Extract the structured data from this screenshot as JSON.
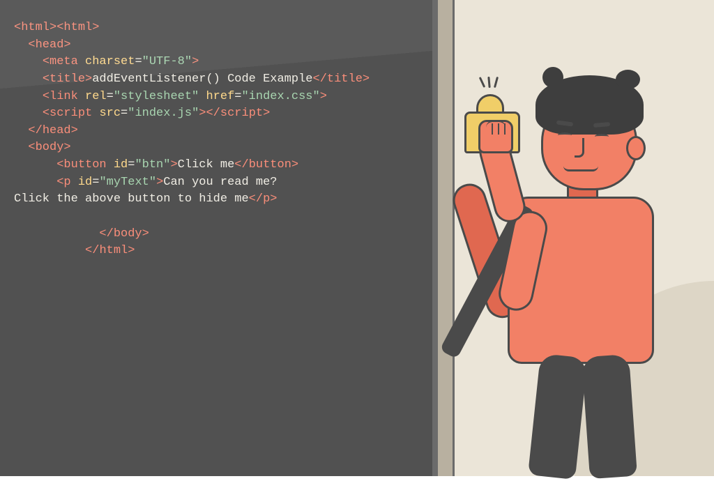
{
  "code": {
    "lines": [
      {
        "indent": 0,
        "segments": [
          {
            "t": "tag",
            "open": "<",
            "name": "html",
            "close": ">"
          },
          {
            "t": "tag",
            "open": "<",
            "name": "html",
            "close": ">"
          }
        ]
      },
      {
        "indent": 1,
        "segments": [
          {
            "t": "tag",
            "open": "<",
            "name": "head",
            "close": ">"
          }
        ]
      },
      {
        "indent": 2,
        "segments": [
          {
            "t": "tag",
            "open": "<",
            "name": "meta",
            "attrs": [
              {
                "n": "charset",
                "v": "UTF-8"
              }
            ],
            "close": ">"
          }
        ]
      },
      {
        "indent": 2,
        "segments": [
          {
            "t": "tag",
            "open": "<",
            "name": "title",
            "close": ">"
          },
          {
            "t": "text",
            "v": "addEventListener() Code Example"
          },
          {
            "t": "tag",
            "open": "</",
            "name": "title",
            "close": ">"
          }
        ]
      },
      {
        "indent": 2,
        "segments": [
          {
            "t": "tag",
            "open": "<",
            "name": "link",
            "attrs": [
              {
                "n": "rel",
                "v": "stylesheet"
              },
              {
                "n": "href",
                "v": "index.css"
              }
            ],
            "close": ">"
          }
        ]
      },
      {
        "indent": 2,
        "segments": [
          {
            "t": "tag",
            "open": "<",
            "name": "script",
            "attrs": [
              {
                "n": "src",
                "v": "index.js"
              }
            ],
            "close": ">"
          },
          {
            "t": "tag",
            "open": "</",
            "name": "script",
            "close": ">"
          }
        ]
      },
      {
        "indent": 1,
        "segments": [
          {
            "t": "tag",
            "open": "</",
            "name": "head",
            "close": ">"
          }
        ]
      },
      {
        "indent": 1,
        "segments": [
          {
            "t": "tag",
            "open": "<",
            "name": "body",
            "close": ">"
          }
        ]
      },
      {
        "indent": 3,
        "segments": [
          {
            "t": "tag",
            "open": "<",
            "name": "button",
            "attrs": [
              {
                "n": "id",
                "v": "btn"
              }
            ],
            "close": ">"
          },
          {
            "t": "text",
            "v": "Click me"
          },
          {
            "t": "tag",
            "open": "</",
            "name": "button",
            "close": ">"
          }
        ]
      },
      {
        "indent": 3,
        "segments": [
          {
            "t": "tag",
            "open": "<",
            "name": "p",
            "attrs": [
              {
                "n": "id",
                "v": "myText"
              }
            ],
            "close": ">"
          },
          {
            "t": "text",
            "v": "Can you read me?"
          }
        ]
      },
      {
        "indent": 0,
        "segments": [
          {
            "t": "text",
            "v": "Click the above button to hide me"
          },
          {
            "t": "tag",
            "open": "</",
            "name": "p",
            "close": ">"
          }
        ]
      },
      {
        "indent": 0,
        "segments": []
      },
      {
        "indent": 6,
        "segments": [
          {
            "t": "tag",
            "open": "</",
            "name": "body",
            "close": ">"
          }
        ]
      },
      {
        "indent": 5,
        "segments": [
          {
            "t": "tag",
            "open": "</",
            "name": "html",
            "close": ">"
          }
        ]
      }
    ]
  }
}
